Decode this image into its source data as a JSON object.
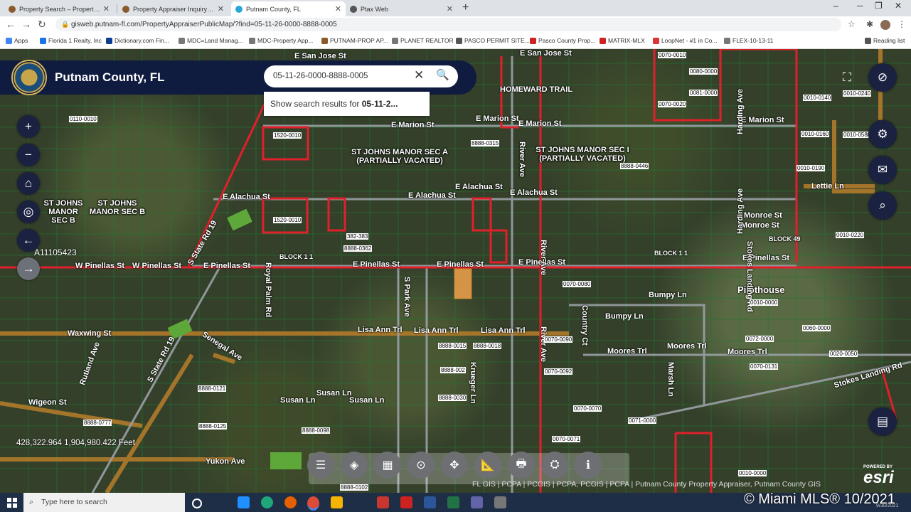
{
  "browser": {
    "tabs": [
      {
        "title": "Property Search – Property Appr",
        "active": false
      },
      {
        "title": "Property Appraiser Inquiry - Putn",
        "active": false
      },
      {
        "title": "Putnam County, FL",
        "active": true
      },
      {
        "title": "Ptax Web",
        "active": false
      }
    ],
    "url": "gisweb.putnam-fl.com/PropertyAppraiserPublicMap/?find=05-11-26-0000-8888-0005",
    "bookmarks": [
      "Apps",
      "Florida 1 Realty, Inc",
      "Dictionary.com Fin...",
      "MDC=Land Manag...",
      "MDC-Property App...",
      "PUTNAM-PROP AP...",
      "PLANET REALTOR",
      "PASCO PERMIT SITE...",
      "Pasco County Prop...",
      "MATRIX-MLX",
      "LoopNet - #1 in Co...",
      "FLEX-10-13-11"
    ],
    "reading_list": "Reading list"
  },
  "app": {
    "title": "Putnam County, FL",
    "search_value": "05-11-26-0000-8888-0005",
    "suggestion_prefix": "Show search results for ",
    "suggestion_term": "05-11-2..."
  },
  "map": {
    "streets": [
      "E San Jose St",
      "E San Jose St",
      "HOMEWARD TRAIL",
      "E Marion St",
      "E Marion St",
      "E Marion St",
      "E Marion St",
      "E Alachua St",
      "E Alachua St",
      "E Alachua St",
      "E Alachua St",
      "W Pinellas St",
      "W Pinellas St",
      "E Pinellas St",
      "E Pinellas St",
      "E Pinellas St",
      "E Pinellas St",
      "E Pinellas St",
      "Monroe St",
      "Monroe St",
      "Lettie Ln",
      "Bumpy Ln",
      "Bumpy Ln",
      "Pilothouse",
      "Waxwing St",
      "Senegal Ave",
      "Lisa Ann Trl",
      "Lisa Ann Trl",
      "Lisa Ann Trl",
      "Moores Trl",
      "Moores Trl",
      "Moores Trl",
      "Susan Ln",
      "Susan Ln",
      "Susan Ln",
      "Wigeon St",
      "Yukon Ave",
      "Stokes Landing Rd",
      "Stokes Landing Rd",
      "S State Rd 19",
      "S State Rd 19",
      "River Ave",
      "River Ave",
      "River Ave",
      "Harding Ave",
      "Harding Ave",
      "Royal Palm Rd",
      "S Park Ave",
      "Krueger Ln",
      "Marsh Ln",
      "Country Ct",
      "Rutland Ave"
    ],
    "subdivisions": [
      "ST JOHNS MANOR SEC A (PARTIALLY VACATED)",
      "ST JOHNS MANOR SEC I (PARTIALLY VACATED)",
      "ST JOHNS MANOR SEC B",
      "ST JOHNS MANOR SEC B"
    ],
    "parcels": [
      "0070-0010",
      "0080-0000",
      "0081-0000",
      "0070-0020",
      "0010-0140",
      "0010-0240",
      "0010-0160",
      "0010-0580",
      "0010-0190",
      "0010-0220",
      "1520-0010",
      "1520-0010",
      "8888-0315",
      "8888-0446",
      "382-383",
      "8888-0362",
      "0070-0080",
      "0010-0000",
      "0072-0000",
      "0060-0000",
      "0070-0090",
      "0070-0092",
      "0070-0131",
      "0020-0050",
      "0070-0070",
      "0071-0000",
      "0070-0071",
      "0010-0000",
      "8888-0015",
      "8888-0018",
      "8888-002",
      "8888-0030",
      "8888-0121",
      "8888-0125",
      "8888-0098",
      "8888-0777",
      "8888-0102",
      "0110-0010"
    ],
    "block_labels": [
      "BLOCK 1 1",
      "BLOCK 1 1",
      "BLOCK 49"
    ],
    "coordinates": "428,322.964 1,904,980.422 Feet",
    "account": "A11105423",
    "attribution": "FL GIS | PCPA | PCGIS | PCPA, PCGIS | PCPA | Putnam County Property Appraiser, Putnam County GIS",
    "powered_by": "POWERED BY",
    "brand": "esri",
    "watermark": "© Miami MLS® 10/2021"
  },
  "taskbar": {
    "search_placeholder": "Type here to search",
    "date": "9/30/2021"
  },
  "colors": {
    "header_bg": "#0f1b3f",
    "parcel_line": "#1a7a2a",
    "boundary_red": "#e0202a",
    "road_brown": "#b07a2a",
    "highlight": "#f2a24b"
  }
}
